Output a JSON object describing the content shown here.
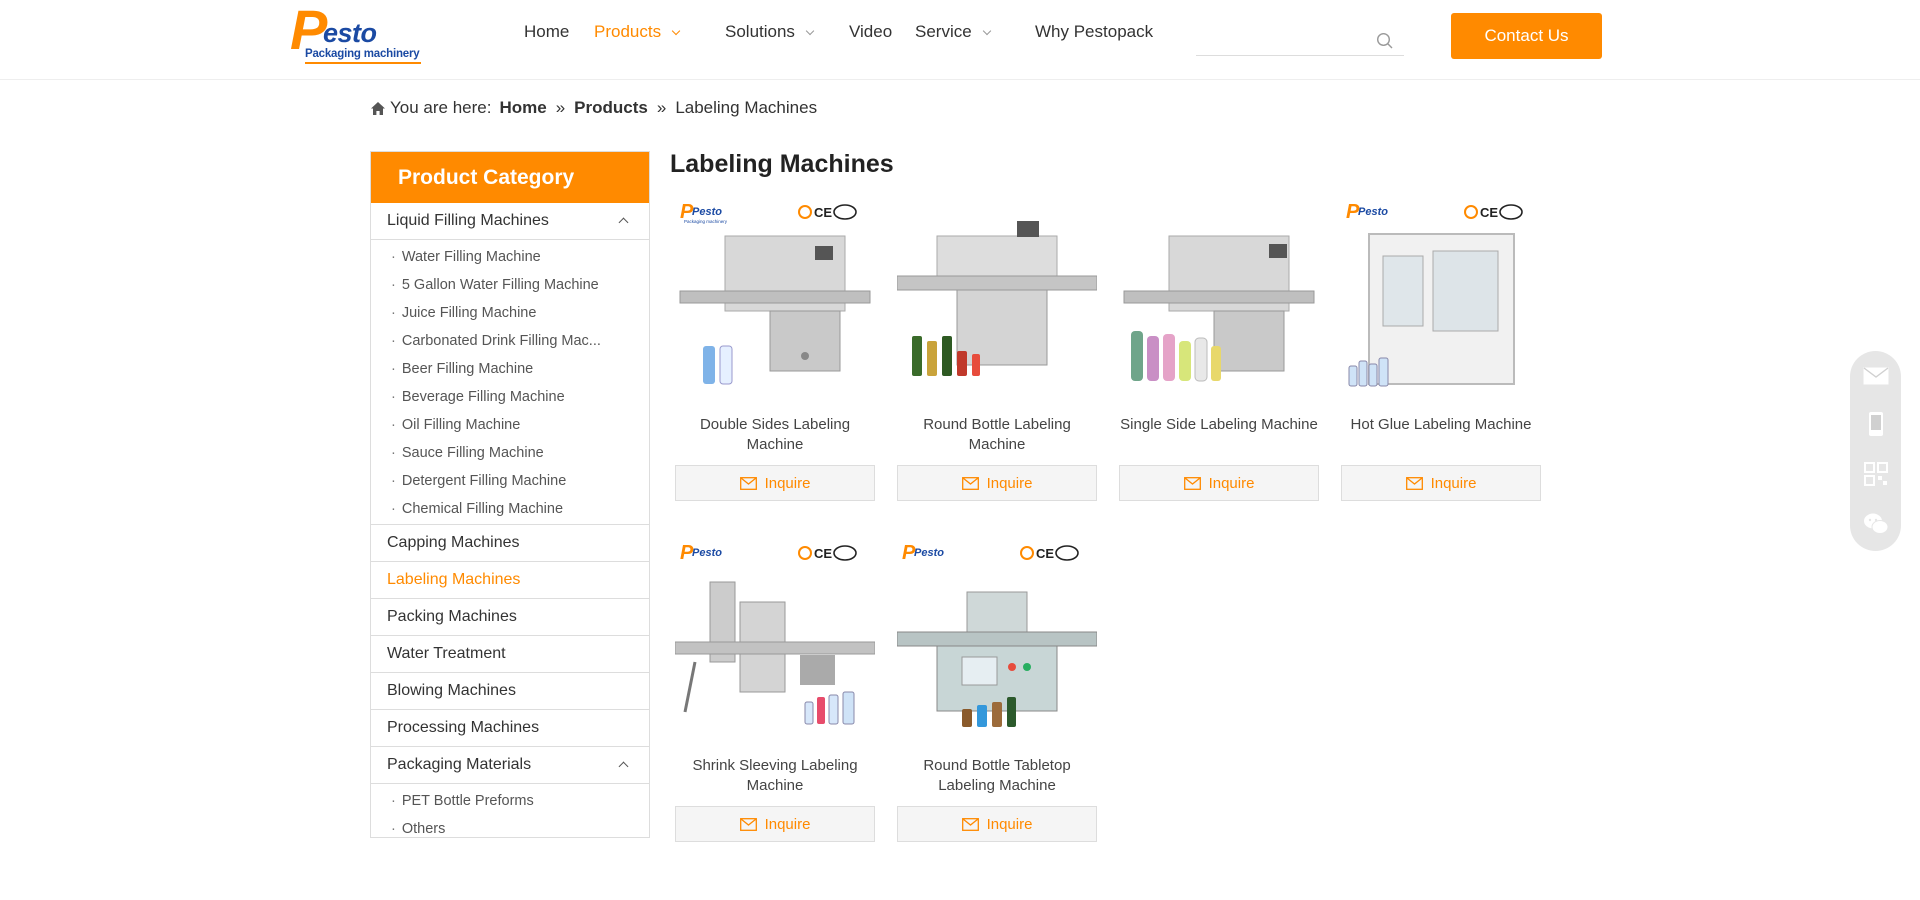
{
  "header": {
    "logo": {
      "letter": "P",
      "name": "esto",
      "tagline": "Packaging machinery"
    },
    "nav": [
      {
        "label": "Home",
        "active": false,
        "dropdown": false
      },
      {
        "label": "Products",
        "active": true,
        "dropdown": true
      },
      {
        "label": "Solutions",
        "active": false,
        "dropdown": true
      },
      {
        "label": "Video",
        "active": false,
        "dropdown": false
      },
      {
        "label": "Service",
        "active": false,
        "dropdown": true
      },
      {
        "label": "Why Pestopack",
        "active": false,
        "dropdown": false
      }
    ],
    "search_value": "",
    "contact_label": "Contact Us"
  },
  "breadcrumb": {
    "prefix": "You are here:",
    "home": "Home",
    "products": "Products",
    "current": "Labeling Machines",
    "separator": "»"
  },
  "sidebar": {
    "title": "Product Category",
    "liquid": {
      "label": "Liquid Filling Machines",
      "items": [
        "Water Filling Machine",
        "5 Gallon Water Filling Machine",
        "Juice Filling Machine",
        "Carbonated Drink Filling Mac...",
        "Beer Filling Machine",
        "Beverage Filling Machine",
        "Oil Filling Machine",
        "Sauce Filling Machine",
        "Detergent Filling Machine",
        "Chemical Filling Machine"
      ]
    },
    "categories": [
      "Capping Machines",
      "Labeling Machines",
      "Packing Machines",
      "Water Treatment",
      "Blowing Machines",
      "Processing Machines"
    ],
    "packaging": {
      "label": "Packaging Materials",
      "items": [
        "PET Bottle Preforms",
        "Others"
      ]
    },
    "bullet": "·"
  },
  "main": {
    "title": "Labeling Machines",
    "inquire_label": "Inquire",
    "products": [
      {
        "name": "Double Sides Labeling Machine"
      },
      {
        "name": "Round Bottle Labeling Machine"
      },
      {
        "name": "Single Side Labeling Machine"
      },
      {
        "name": "Hot Glue Labeling Machine"
      },
      {
        "name": "Shrink Sleeving Labeling Machine"
      },
      {
        "name": "Round Bottle Tabletop Labeling Machine"
      }
    ],
    "badge": {
      "brand": "Pesto",
      "brand_sub": "Packaging machinery",
      "ce": "CE"
    }
  },
  "colors": {
    "accent": "#ff8a00",
    "brand_blue": "#1b4aa3"
  },
  "floating_toolbar": [
    "mail-icon",
    "mobile-icon",
    "qr-code-icon",
    "wechat-icon"
  ]
}
